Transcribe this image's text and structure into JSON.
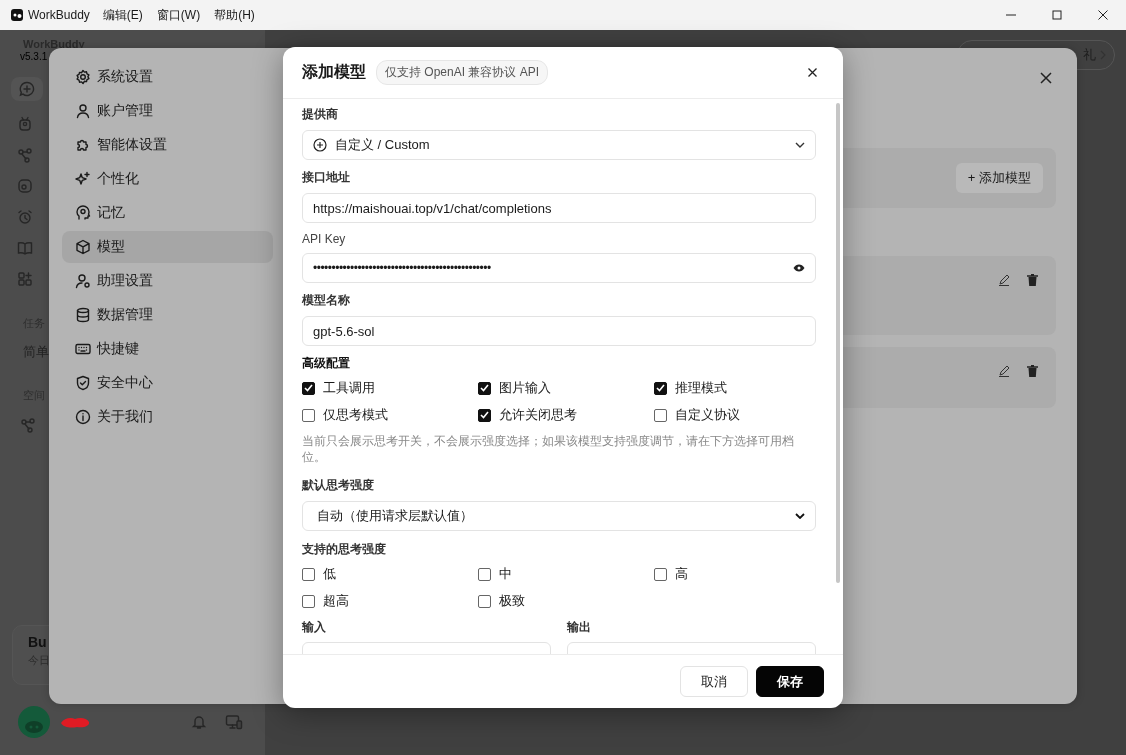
{
  "titlebar": {
    "app_name": "WorkBuddy",
    "menus": [
      "编辑(E)",
      "窗口(W)",
      "帮助(H)"
    ]
  },
  "background_app": {
    "app_name": "WorkBuddy",
    "version": "v5.3.1",
    "task_label": "任务",
    "task_item": "简单",
    "space_label": "空间",
    "card": {
      "title": "Bu",
      "subtitle": "今日"
    },
    "promo_button": "礼"
  },
  "settings": {
    "nav": [
      {
        "label": "系统设置",
        "selected": false
      },
      {
        "label": "账户管理",
        "selected": false
      },
      {
        "label": "智能体设置",
        "selected": false
      },
      {
        "label": "个性化",
        "selected": false
      },
      {
        "label": "记忆",
        "selected": false
      },
      {
        "label": "模型",
        "selected": true
      },
      {
        "label": "助理设置",
        "selected": false
      },
      {
        "label": "数据管理",
        "selected": false
      },
      {
        "label": "快捷键",
        "selected": false
      },
      {
        "label": "安全中心",
        "selected": false
      },
      {
        "label": "关于我们",
        "selected": false
      }
    ],
    "add_model_button": "+ 添加模型",
    "models": [
      {
        "kind": "model"
      },
      {
        "kind": "model"
      }
    ]
  },
  "dialog": {
    "title": "添加模型",
    "badge": "仅支持 OpenAI 兼容协议 API",
    "fields": [
      {
        "kind": "select",
        "label": "提供商",
        "value": "自定义 / Custom"
      },
      {
        "kind": "text",
        "label": "接口地址",
        "value": "https://maishouai.top/v1/chat/completions"
      },
      {
        "kind": "secret",
        "label": "API Key",
        "value": "••••••••••••••••••••••••••••••••••••••••••••••••"
      },
      {
        "kind": "text",
        "label": "模型名称",
        "value": "gpt-5.6-sol"
      }
    ],
    "advanced": {
      "label": "高级配置",
      "options": [
        {
          "label": "工具调用",
          "checked": true
        },
        {
          "label": "图片输入",
          "checked": true
        },
        {
          "label": "推理模式",
          "checked": true
        },
        {
          "label": "仅思考模式",
          "checked": false
        },
        {
          "label": "允许关闭思考",
          "checked": true
        },
        {
          "label": "自定义协议",
          "checked": false
        }
      ]
    },
    "hint": "当前只会展示思考开关，不会展示强度选择；如果该模型支持强度调节，请在下方选择可用档位。",
    "default_effort": {
      "label": "默认思考强度",
      "value": "自动（使用请求层默认值）"
    },
    "efforts": {
      "label": "支持的思考强度",
      "options": [
        {
          "label": "低",
          "checked": false
        },
        {
          "label": "中",
          "checked": false
        },
        {
          "label": "高",
          "checked": false
        },
        {
          "label": "超高",
          "checked": false
        },
        {
          "label": "极致",
          "checked": false
        }
      ]
    },
    "io": [
      {
        "label": "输入"
      },
      {
        "label": "输出"
      }
    ],
    "buttons": [
      {
        "label": "取消",
        "kind": "secondary"
      },
      {
        "label": "保存",
        "kind": "primary"
      }
    ]
  }
}
